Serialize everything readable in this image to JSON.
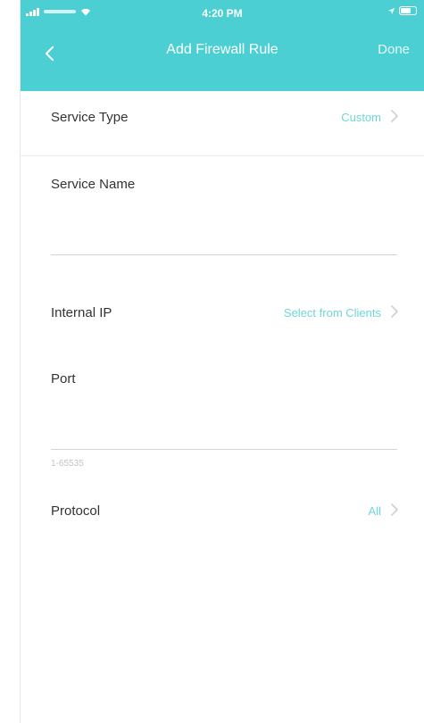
{
  "status_bar": {
    "time": "4:20 PM"
  },
  "nav": {
    "title": "Add Firewall Rule",
    "done_label": "Done"
  },
  "form": {
    "service_type": {
      "label": "Service Type",
      "value": "Custom"
    },
    "service_name": {
      "label": "Service Name",
      "value": ""
    },
    "internal_ip": {
      "label": "Internal IP",
      "value": "Select from Clients"
    },
    "port": {
      "label": "Port",
      "value": "",
      "hint": "1-65535"
    },
    "protocol": {
      "label": "Protocol",
      "value": "All"
    }
  },
  "colors": {
    "header": "#4ccfd2",
    "accent": "#6fd6d8"
  },
  "icons": {
    "back": "chevron-left-icon",
    "row_arrow": "chevron-right-icon"
  }
}
